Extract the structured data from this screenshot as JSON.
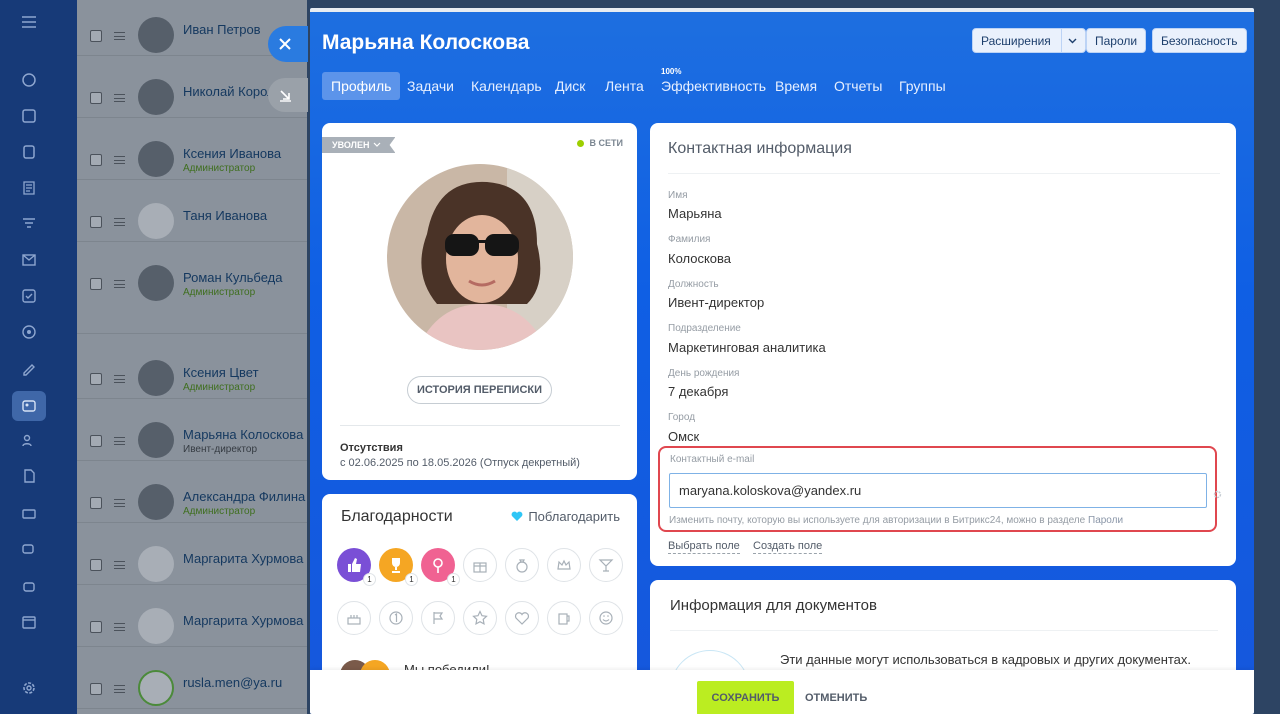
{
  "header": {
    "user_name": "Марьяна Колоскова",
    "extensions_label": "Расширения",
    "passwords_label": "Пароли",
    "security_label": "Безопасность"
  },
  "tabs": [
    {
      "label": "Профиль",
      "active": true
    },
    {
      "label": "Задачи"
    },
    {
      "label": "Календарь"
    },
    {
      "label": "Диск"
    },
    {
      "label": "Лента"
    },
    {
      "label": "Эффективность",
      "badge": "100%"
    },
    {
      "label": "Время"
    },
    {
      "label": "Отчеты"
    },
    {
      "label": "Группы"
    }
  ],
  "profile": {
    "status_tag": "УВОЛЕН",
    "online_label": "В СЕТИ",
    "history_button": "ИСТОРИЯ ПЕРЕПИСКИ",
    "absences_title": "Отсутствия",
    "absences_text": "с 02.06.2025 по 18.05.2026 (Отпуск декретный)"
  },
  "thanks": {
    "title": "Благодарности",
    "thank_button": "Поблагодарить",
    "badge_counts": [
      "1",
      "1",
      "1"
    ],
    "post_preview": "Мы победили!"
  },
  "contact": {
    "title": "Контактная информация",
    "fields": [
      {
        "label": "Имя",
        "value": "Марьяна"
      },
      {
        "label": "Фамилия",
        "value": "Колоскова"
      },
      {
        "label": "Должность",
        "value": "Ивент-директор"
      },
      {
        "label": "Подразделение",
        "value": "Маркетинговая аналитика"
      },
      {
        "label": "День рождения",
        "value": "7 декабря"
      },
      {
        "label": "Город",
        "value": "Омск"
      }
    ],
    "email_label": "Контактный e-mail",
    "email_value": "maryana.koloskova@yandex.ru",
    "email_note": "Изменить почту, которую вы используете для авторизации в Битрикс24, можно в разделе",
    "email_note_link": "Пароли",
    "choose_field": "Выбрать поле",
    "create_field": "Создать поле"
  },
  "docs": {
    "title": "Информация для документов",
    "text": "Эти данные могут использоваться в кадровых и других документах."
  },
  "footer": {
    "save_label": "СОХРАНИТЬ",
    "cancel_label": "ОТМЕНИТЬ"
  },
  "employee_list": [
    {
      "name": "Иван Петров",
      "role": ""
    },
    {
      "name": "Николай Король",
      "role": ""
    },
    {
      "name": "Ксения Иванова",
      "role": "Администратор"
    },
    {
      "name": "Таня Иванова",
      "role": ""
    },
    {
      "name": "Роман Кульбеда",
      "role": "Администратор"
    },
    {
      "name": "Ксения Цвет",
      "role": "Администратор"
    },
    {
      "name": "Марьяна Колоскова",
      "role": "Ивент-директор"
    },
    {
      "name": "Александра Филина",
      "role": "Администратор"
    },
    {
      "name": "Маргарита Хурмова",
      "role": ""
    },
    {
      "name": "Маргарита Хурмова",
      "role": ""
    },
    {
      "name": "rusla.men@ya.ru",
      "role": ""
    }
  ],
  "colors": {
    "panel_blue": "#1e6fe0",
    "save_green": "#bbed21",
    "highlight_red": "#e0474f",
    "online_green": "#9dcf00"
  }
}
